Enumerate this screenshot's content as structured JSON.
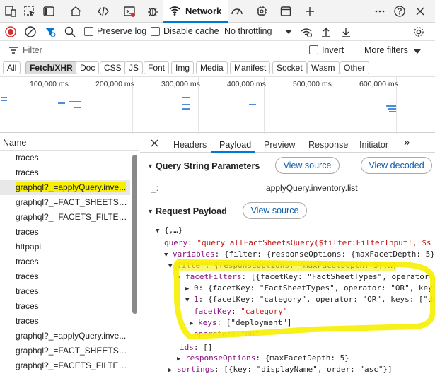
{
  "tabs": {
    "network_label": "Network",
    "icons": [
      "device-toggle-icon",
      "inspect-icon",
      "toggle-panel-icon",
      "welcome-icon",
      "elements-icon",
      "console-icon",
      "sources-icon",
      "network-icon",
      "performance-icon",
      "memory-icon",
      "application-icon",
      "add-tool-icon",
      "more-tools-icon",
      "help-icon",
      "close-devtools-icon"
    ]
  },
  "toolbar": {
    "preserve_log": "Preserve log",
    "disable_cache": "Disable cache",
    "throttling": "No throttling"
  },
  "filter": {
    "placeholder": "Filter",
    "invert": "Invert",
    "more_filters": "More filters"
  },
  "type_filters": [
    "All",
    "Fetch/XHR",
    "Doc",
    "CSS",
    "JS",
    "Font",
    "Img",
    "Media",
    "Manifest",
    "Socket",
    "Wasm",
    "Other"
  ],
  "overview": {
    "ticks": [
      "100,000 ms",
      "200,000 ms",
      "300,000 ms",
      "400,000 ms",
      "500,000 ms",
      "600,000 ms"
    ]
  },
  "list": {
    "header": "Name",
    "rows": [
      "traces",
      "traces",
      "graphql?_=applyQuery.inve...",
      "graphql?_=FACT_SHEETS_PE...",
      "graphql?_=FACETS_FILTER_...",
      "traces",
      "httpapi",
      "traces",
      "traces",
      "traces",
      "traces",
      "traces",
      "graphql?_=applyQuery.inve...",
      "graphql?_=FACT_SHEETS_PE...",
      "graphql?_=FACETS_FILTER_..."
    ]
  },
  "detail": {
    "tabs": [
      "Headers",
      "Payload",
      "Preview",
      "Response",
      "Initiator"
    ],
    "query_string": {
      "title": "Query String Parameters",
      "view_source": "View source",
      "view_decoded": "View decoded",
      "param_key": "_:",
      "param_value": "applyQuery.inventory.list"
    },
    "request_payload": {
      "title": "Request Payload",
      "view_source": "View source",
      "root": "{,…}",
      "query_key": "query",
      "query_value": "\"query allFactSheetsQuery($filter:FilterInput!, $s",
      "variables_key": "variables",
      "variables_value": "{filter: {responseOptions: {maxFacetDepth: 5}",
      "filter_key": "filter",
      "filter_value": "{responseOptions: {maxFacetDepth: 5},…}",
      "facetFilters_key": "facetFilters",
      "facetFilters_value": "[{facetKey: \"FactSheetTypes\", operator:",
      "item0_key": "0",
      "item0_value": "{facetKey: \"FactSheetTypes\", operator: \"OR\", keys",
      "item1_key": "1",
      "item1_value": "{facetKey: \"category\", operator: \"OR\", keys: [\"de",
      "facetKey_key": "facetKey",
      "facetKey_value": "\"category\"",
      "keys_key": "keys",
      "keys_value": "[\"deployment\"]",
      "operator_key": "operator",
      "operator_value": "\"OR\"",
      "ids_key": "ids",
      "ids_value": "[]",
      "responseOptions_key": "responseOptions",
      "responseOptions_value": "{maxFacetDepth: 5}",
      "sortings_key": "sortings",
      "sortings_value": "[{key: \"displayName\", order: \"asc\"}]"
    }
  },
  "colors": {
    "accent": "#0078d4",
    "highlight": "#f7ef00",
    "record_red": "#d32f2f",
    "json_key": "#881280",
    "json_string": "#c41a16"
  }
}
